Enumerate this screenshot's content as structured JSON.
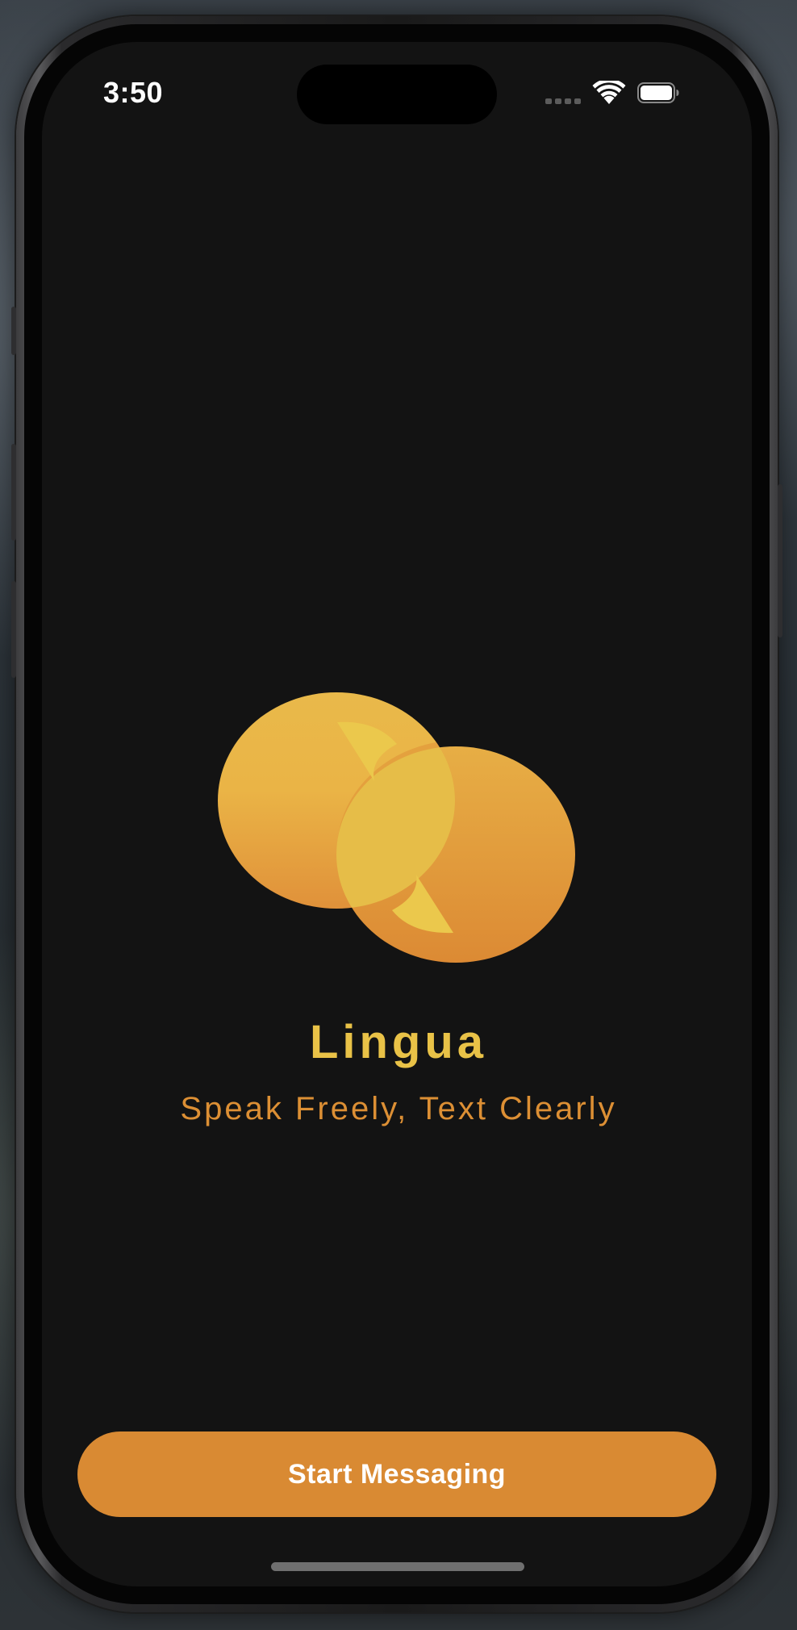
{
  "status_bar": {
    "time": "3:50",
    "icons": [
      "cellular-signal-icon",
      "wifi-icon",
      "battery-icon"
    ]
  },
  "app": {
    "title": "Lingua",
    "tagline": "Speak Freely, Text Clearly",
    "logo_icon": "overlapping-speech-bubbles-icon"
  },
  "actions": {
    "start_label": "Start Messaging"
  },
  "colors": {
    "background": "#131313",
    "title": "#e9c247",
    "tagline": "#dc8f34",
    "button": "#d98a33",
    "button_text": "#ffffff",
    "logo_top": "#ecc24d",
    "logo_bottom": "#de8a35"
  }
}
